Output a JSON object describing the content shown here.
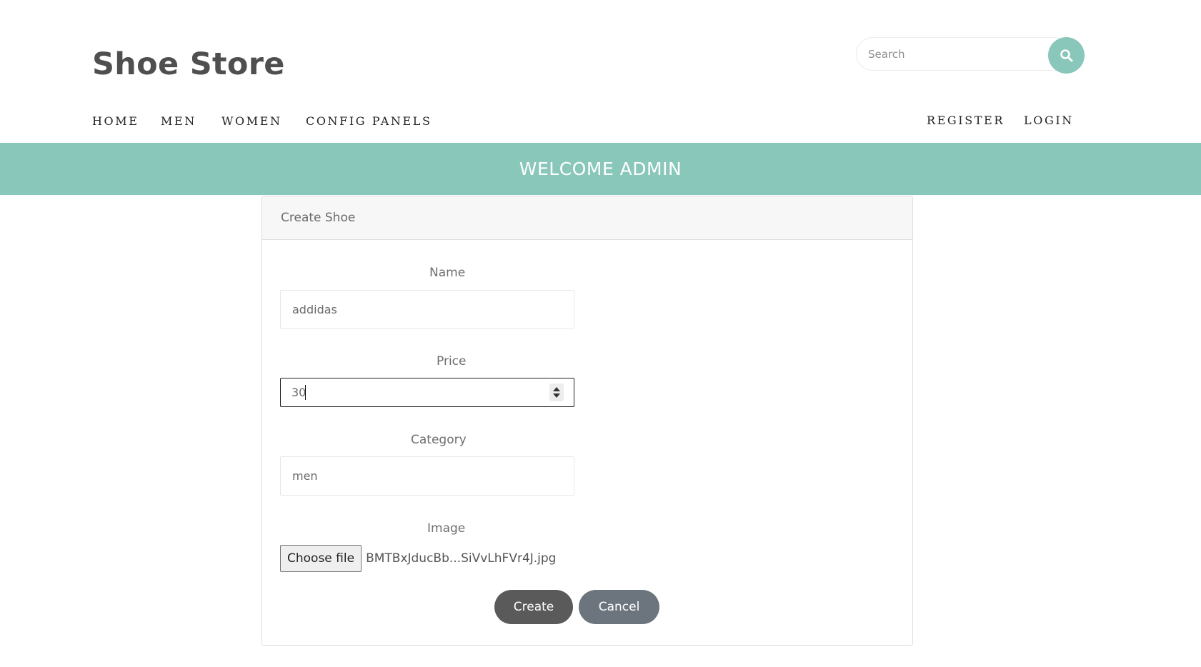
{
  "header": {
    "brand": "Shoe Store",
    "search": {
      "placeholder": "Search",
      "icon": "search-icon"
    }
  },
  "nav": {
    "left": [
      "HOME",
      "MEN",
      "WOMEN",
      "CONFIG PANELS"
    ],
    "right": [
      "REGISTER",
      "LOGIN"
    ]
  },
  "banner": {
    "text": "WELCOME ADMIN"
  },
  "form": {
    "title": "Create Shoe",
    "name": {
      "label": "Name",
      "value": "addidas"
    },
    "price": {
      "label": "Price",
      "value": "30"
    },
    "category": {
      "label": "Category",
      "value": "men"
    },
    "image": {
      "label": "Image",
      "button": "Choose file",
      "file_name": "BMTBxJducBb...SiVvLhFVr4J.jpg"
    },
    "create_label": "Create",
    "cancel_label": "Cancel"
  },
  "colors": {
    "accent": "#89c7ba",
    "create_button": "#5a5a5a",
    "cancel_button": "#6c757d"
  }
}
